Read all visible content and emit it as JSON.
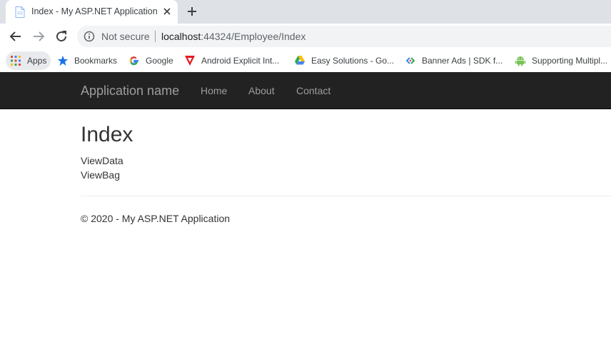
{
  "browser": {
    "tab": {
      "title": "Index - My ASP.NET Application",
      "favicon": "page-icon"
    },
    "toolbar": {
      "security_label": "Not secure",
      "url_host": "localhost",
      "url_rest": ":44324/Employee/Index"
    },
    "bookmarks": [
      {
        "label": "Apps",
        "icon": "apps-grid-icon"
      },
      {
        "label": "Bookmarks",
        "icon": "star-icon"
      },
      {
        "label": "Google",
        "icon": "google-icon"
      },
      {
        "label": "Android Explicit Int...",
        "icon": "red-triangle-icon"
      },
      {
        "label": "Easy Solutions - Go...",
        "icon": "drive-icon"
      },
      {
        "label": "Banner Ads | SDK f...",
        "icon": "admob-icon"
      },
      {
        "label": "Supporting Multipl...",
        "icon": "android-icon"
      }
    ]
  },
  "navbar": {
    "brand": "Application name",
    "links": [
      "Home",
      "About",
      "Contact"
    ]
  },
  "main": {
    "title": "Index",
    "lines": [
      "ViewData",
      "ViewBag"
    ]
  },
  "footer": {
    "text": "© 2020 - My ASP.NET Application"
  },
  "colors": {
    "navbar_bg": "#222222",
    "nav_text": "#9d9d9d",
    "body_text": "#333333"
  }
}
